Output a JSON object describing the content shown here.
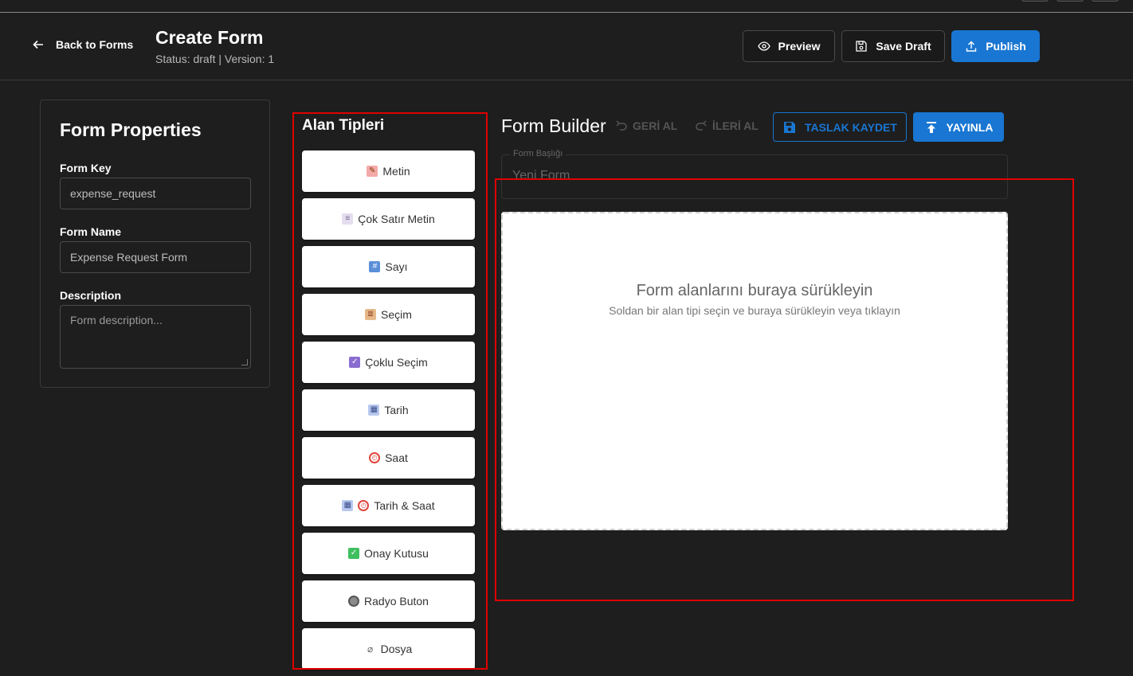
{
  "header": {
    "back_label": "Back to Forms",
    "title": "Create Form",
    "status": "Status: draft | Version: 1",
    "preview_label": "Preview",
    "save_draft_label": "Save Draft",
    "publish_label": "Publish"
  },
  "properties": {
    "title": "Form Properties",
    "form_key_label": "Form Key",
    "form_key_value": "expense_request",
    "form_name_label": "Form Name",
    "form_name_value": "Expense Request Form",
    "description_label": "Description",
    "description_placeholder": "Form description..."
  },
  "field_types": {
    "title": "Alan Tipleri",
    "items": [
      {
        "label": "Metin",
        "icon": "memo-icon"
      },
      {
        "label": "Çok Satır Metin",
        "icon": "page-icon"
      },
      {
        "label": "Sayı",
        "icon": "numbers-icon"
      },
      {
        "label": "Seçim",
        "icon": "clipboard-icon"
      },
      {
        "label": "Çoklu Seçim",
        "icon": "checkbox-icon"
      },
      {
        "label": "Tarih",
        "icon": "calendar-icon"
      },
      {
        "label": "Saat",
        "icon": "alarm-clock-icon"
      },
      {
        "label": "Tarih & Saat",
        "icon": "calendar-clock-icon"
      },
      {
        "label": "Onay Kutusu",
        "icon": "check-mark-icon"
      },
      {
        "label": "Radyo Buton",
        "icon": "radio-icon"
      },
      {
        "label": "Dosya",
        "icon": "paperclip-icon"
      }
    ]
  },
  "builder": {
    "title": "Form Builder",
    "undo_label": "GERİ AL",
    "redo_label": "İLERİ AL",
    "save_draft_label": "TASLAK KAYDET",
    "publish_label": "YAYINLA",
    "form_title_label": "Form Başlığı",
    "form_title_value": "Yeni Form",
    "drop_title": "Form alanlarını buraya sürükleyin",
    "drop_subtitle": "Soldan bir alan tipi seçin ve buraya sürükleyin veya tıklayın"
  },
  "colors": {
    "accent": "#1976d2",
    "background": "#1e1e1e",
    "highlight": "#e00000"
  }
}
